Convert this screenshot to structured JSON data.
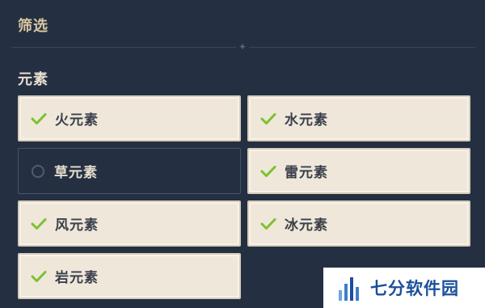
{
  "header": {
    "title": "筛选"
  },
  "section": {
    "title": "元素"
  },
  "options": [
    {
      "label": "火元素",
      "selected": true
    },
    {
      "label": "水元素",
      "selected": true
    },
    {
      "label": "草元素",
      "selected": false
    },
    {
      "label": "雷元素",
      "selected": true
    },
    {
      "label": "风元素",
      "selected": true
    },
    {
      "label": "冰元素",
      "selected": true
    },
    {
      "label": "岩元素",
      "selected": true
    }
  ],
  "logo": {
    "text": "七分软件园"
  },
  "colors": {
    "background": "#243042",
    "selected_bg": "#efe7da",
    "check": "#7cc12f",
    "title": "#d9c7a0",
    "logo": "#1b4f9c"
  },
  "icons": {
    "selected": "check-icon",
    "unselected": "radio-empty-icon",
    "divider": "star-icon"
  }
}
